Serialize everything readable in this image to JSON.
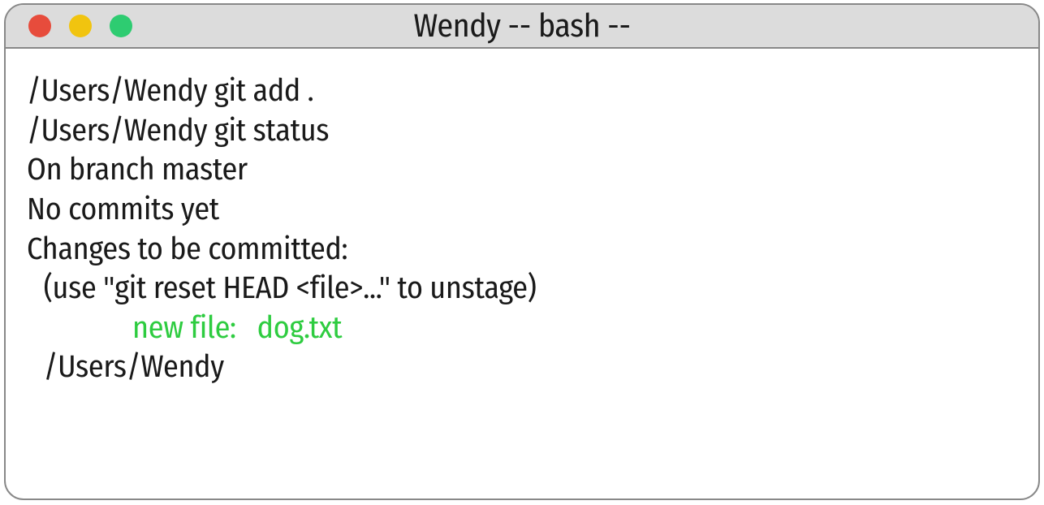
{
  "window": {
    "title": "Wendy -- bash --"
  },
  "terminal": {
    "lines": {
      "l1": "/Users/Wendy git add .",
      "l2": "/Users/Wendy git status",
      "l3": "On branch master",
      "l4": "No commits yet",
      "l5": "Changes to be committed:",
      "l6": " (use \"git reset HEAD <file>...\" to unstage)",
      "l7": "new file:   dog.txt",
      "l8": " /Users/Wendy"
    }
  },
  "colors": {
    "close": "#e74c3c",
    "minimize": "#f1c40f",
    "maximize": "#2ecc71",
    "staged": "#2ecc40"
  }
}
